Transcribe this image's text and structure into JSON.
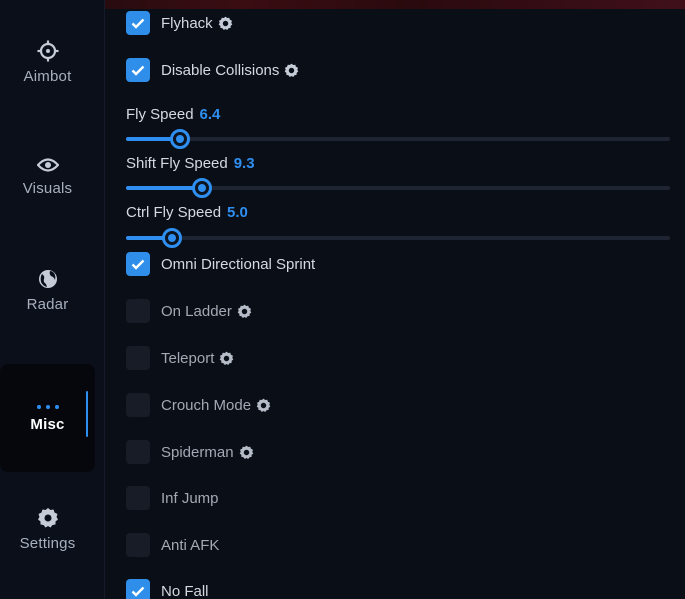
{
  "sidebar": {
    "items": [
      {
        "label": "Aimbot",
        "icon": "crosshair-icon"
      },
      {
        "label": "Visuals",
        "icon": "eye-icon"
      },
      {
        "label": "Radar",
        "icon": "globe-icon"
      },
      {
        "label": "Misc",
        "icon": "dots-icon",
        "active": true
      },
      {
        "label": "Settings",
        "icon": "gear-icon"
      }
    ]
  },
  "options": {
    "flyhack": {
      "label": "Flyhack",
      "checked": true,
      "has_settings": true
    },
    "disable_collisions": {
      "label": "Disable Collisions",
      "checked": true,
      "has_settings": true
    },
    "omni_sprint": {
      "label": "Omni Directional Sprint",
      "checked": true,
      "has_settings": false
    },
    "on_ladder": {
      "label": "On Ladder",
      "checked": false,
      "has_settings": true
    },
    "teleport": {
      "label": "Teleport",
      "checked": false,
      "has_settings": true
    },
    "crouch_mode": {
      "label": "Crouch Mode",
      "checked": false,
      "has_settings": true
    },
    "spiderman": {
      "label": "Spiderman",
      "checked": false,
      "has_settings": true
    },
    "inf_jump": {
      "label": "Inf Jump",
      "checked": false,
      "has_settings": false
    },
    "anti_afk": {
      "label": "Anti AFK",
      "checked": false,
      "has_settings": false
    },
    "no_fall": {
      "label": "No Fall",
      "checked": true,
      "has_settings": false
    }
  },
  "sliders": {
    "fly_speed": {
      "label": "Fly Speed",
      "value": "6.4",
      "fraction": 0.1
    },
    "shift_fly_speed": {
      "label": "Shift Fly Speed",
      "value": "9.3",
      "fraction": 0.14
    },
    "ctrl_fly_speed": {
      "label": "Ctrl Fly Speed",
      "value": "5.0",
      "fraction": 0.085
    }
  },
  "colors": {
    "accent": "#2f8ff0",
    "background": "#0a0e17",
    "sidebar": "#0b0f19"
  }
}
